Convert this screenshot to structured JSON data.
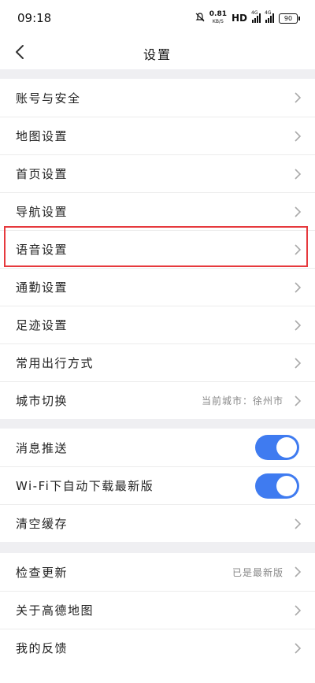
{
  "status_bar": {
    "time": "09:18",
    "net_speed_value": "0.81",
    "net_speed_unit": "KB/S",
    "hd_label": "HD",
    "signal_1_label": "4G",
    "signal_2_label": "4G",
    "battery": "90"
  },
  "header": {
    "title": "设置"
  },
  "groups": [
    {
      "items": [
        {
          "label": "账号与安全"
        },
        {
          "label": "地图设置"
        },
        {
          "label": "首页设置"
        },
        {
          "label": "导航设置"
        },
        {
          "label": "语音设置"
        },
        {
          "label": "通勤设置"
        },
        {
          "label": "足迹设置"
        },
        {
          "label": "常用出行方式"
        },
        {
          "label": "城市切换",
          "value": "当前城市：徐州市"
        }
      ]
    },
    {
      "items": [
        {
          "label": "消息推送",
          "toggle": true
        },
        {
          "label": "Wi-Fi下自动下载最新版",
          "toggle": true
        },
        {
          "label": "清空缓存"
        }
      ]
    },
    {
      "items": [
        {
          "label": "检查更新",
          "value": "已是最新版"
        },
        {
          "label": "关于高德地图"
        },
        {
          "label": "我的反馈"
        }
      ]
    }
  ],
  "accent_color": "#3f7bf0",
  "highlight_color": "#e6393d"
}
